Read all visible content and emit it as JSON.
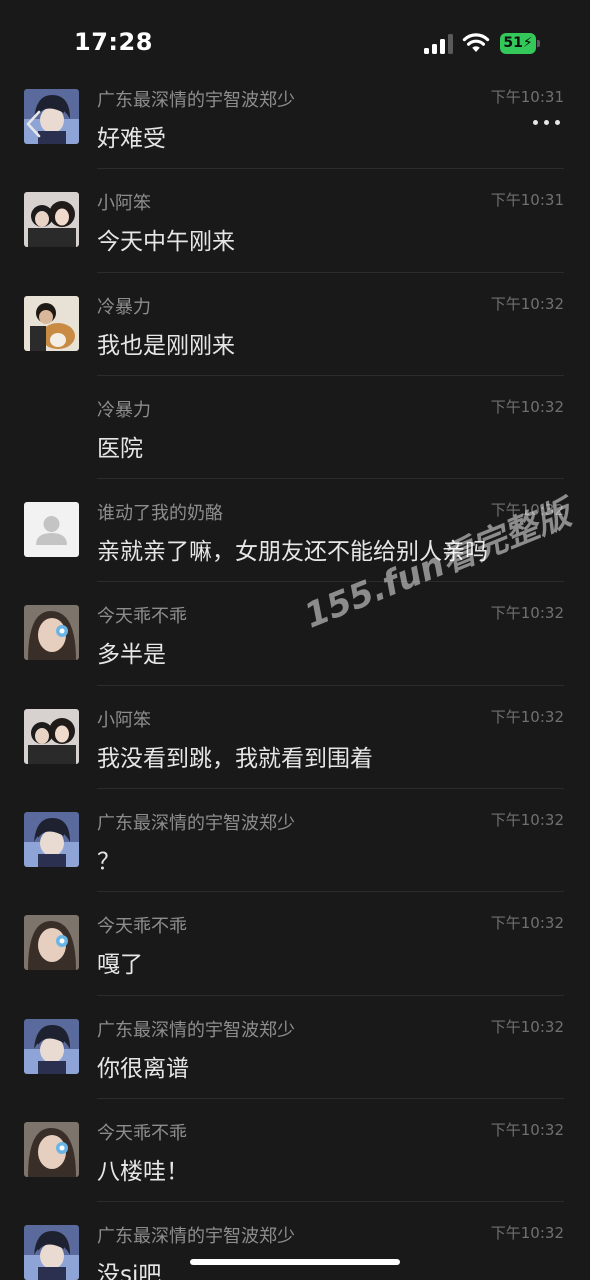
{
  "status_bar": {
    "time": "17:28",
    "battery": "51",
    "icons": [
      "cellular-signal-icon",
      "wifi-icon",
      "battery-charging-icon"
    ]
  },
  "header": {
    "back_icon": "chevron-left-icon",
    "more_icon": "more-dots-icon"
  },
  "messages": [
    {
      "sender": "广东最深情的宇智波郑少",
      "time": "下午10:31",
      "text": "好难受",
      "avatar": "anime-boy"
    },
    {
      "sender": "小阿笨",
      "time": "下午10:31",
      "text": "今天中午刚来",
      "avatar": "couple-photo"
    },
    {
      "sender": "冷暴力",
      "time": "下午10:32",
      "text": "我也是刚刚来",
      "avatar": "person-with-dog"
    },
    {
      "sender": "冷暴力",
      "time": "下午10:32",
      "text": "医院",
      "avatar": "none"
    },
    {
      "sender": "谁动了我的奶酪",
      "time": "下午10:32",
      "text": "亲就亲了嘛，女朋友还不能给别人亲吗",
      "avatar": "default-gray"
    },
    {
      "sender": "今天乖不乖",
      "time": "下午10:32",
      "text": "多半是",
      "avatar": "girl-selfie"
    },
    {
      "sender": "小阿笨",
      "time": "下午10:32",
      "text": "我没看到跳，我就看到围着",
      "avatar": "couple-photo"
    },
    {
      "sender": "广东最深情的宇智波郑少",
      "time": "下午10:32",
      "text": "？",
      "avatar": "anime-boy"
    },
    {
      "sender": "今天乖不乖",
      "time": "下午10:32",
      "text": "嘎了",
      "avatar": "girl-selfie"
    },
    {
      "sender": "广东最深情的宇智波郑少",
      "time": "下午10:32",
      "text": "你很离谱",
      "avatar": "anime-boy"
    },
    {
      "sender": "今天乖不乖",
      "time": "下午10:32",
      "text": "八楼哇！",
      "avatar": "girl-selfie"
    },
    {
      "sender": "广东最深情的宇智波郑少",
      "time": "下午10:32",
      "text": "没si吧",
      "avatar": "anime-boy"
    }
  ],
  "watermark": "155.fun看完整版",
  "colors": {
    "background": "#191919",
    "battery_green": "#34c759",
    "sender_gray": "#8d8d8d"
  }
}
